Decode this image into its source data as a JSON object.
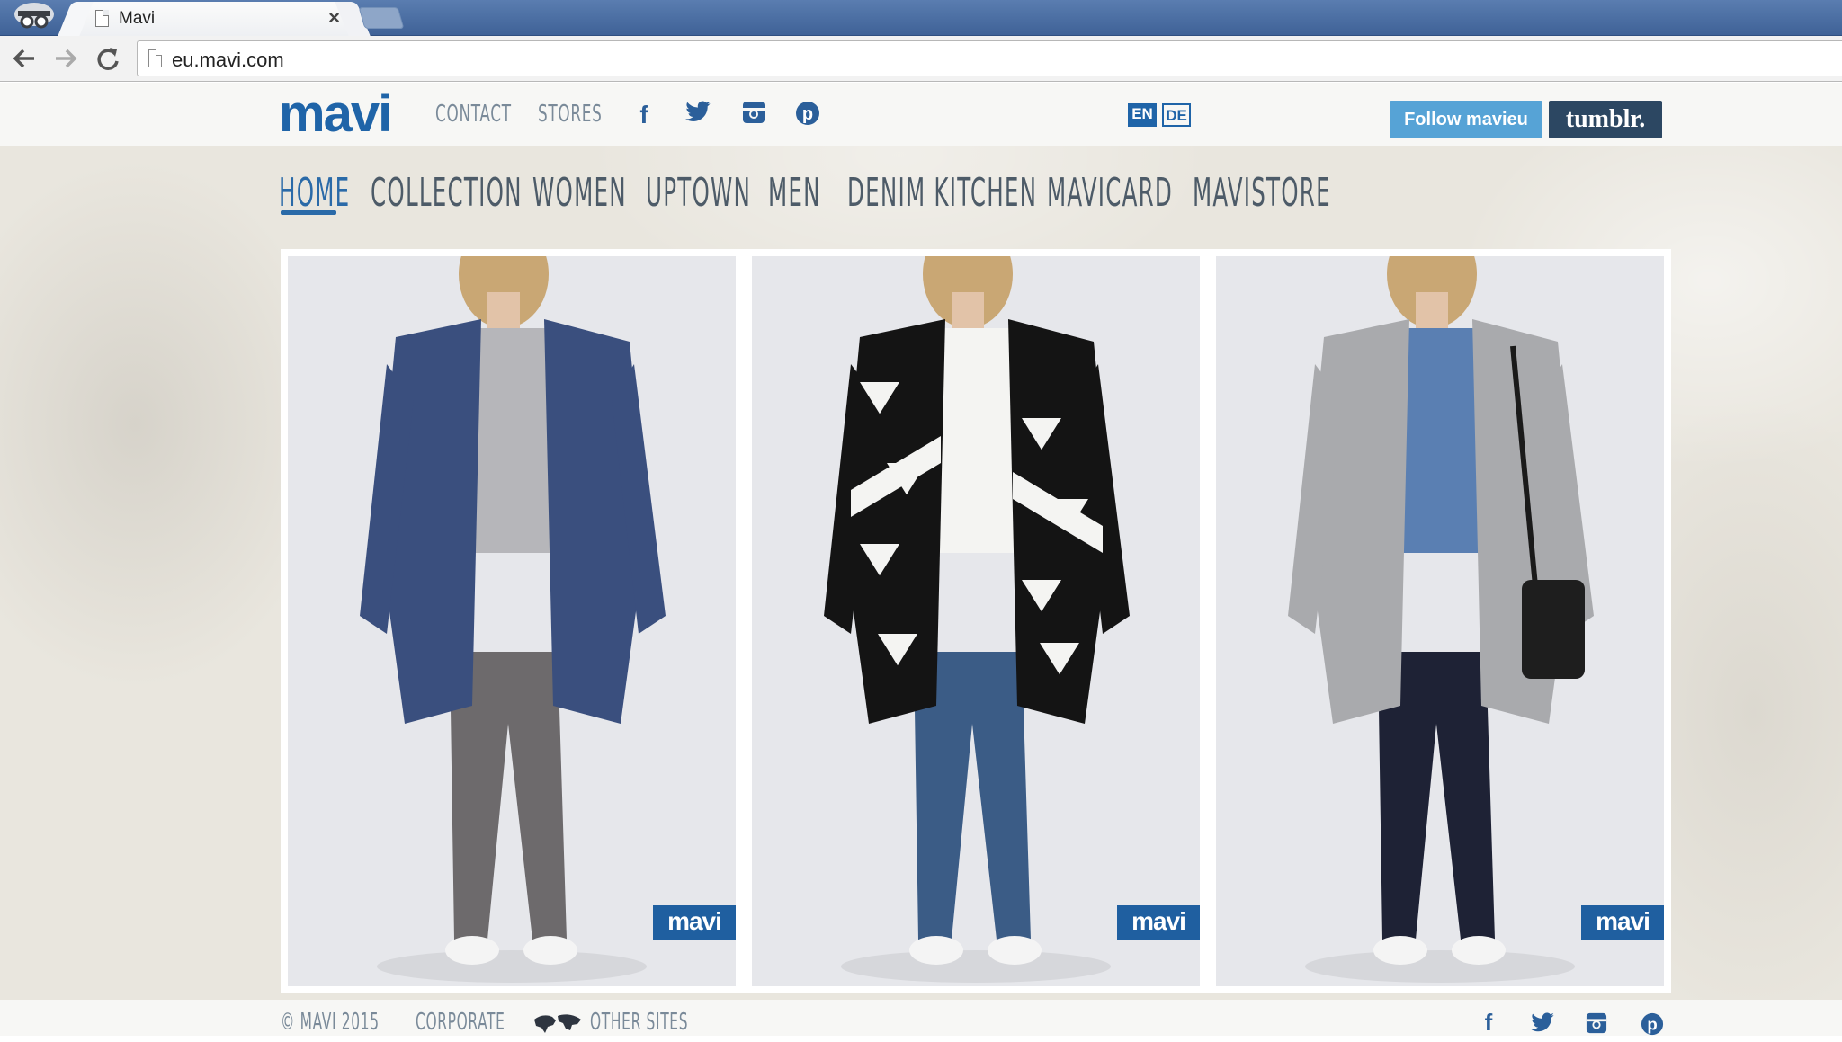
{
  "browser": {
    "tab_title": "Mavi",
    "tab_close": "×",
    "url": "eu.mavi.com"
  },
  "header": {
    "logo": "mavi",
    "links": [
      "CONTACT",
      "STORES"
    ],
    "social_icons": [
      "facebook-icon",
      "twitter-icon",
      "instagram-icon",
      "pinterest-icon"
    ],
    "languages": [
      "EN",
      "DE"
    ],
    "follow_label": "Follow mavieu",
    "tumblr_label": "tumblr."
  },
  "nav": {
    "items": [
      "HOME",
      "COLLECTION",
      "WOMEN",
      "UPTOWN",
      "MEN",
      "DENIM KITCHEN",
      "MAVICARD",
      "MAVISTORE"
    ],
    "active": "HOME"
  },
  "gallery": {
    "badge": "mavi",
    "cards": [
      {
        "coat": "#3a4f7e",
        "coat_inner": "#b6b6ba",
        "pants": "#6d6a6c"
      },
      {
        "coat": "#141414",
        "coat_inner": "#f4f4f2",
        "pants": "#3b5c86"
      },
      {
        "coat": "#a9aaad",
        "coat_inner": "#5a7fb2",
        "pants": "#1e2235"
      }
    ]
  },
  "footer": {
    "copyright": "© MAVI 2015",
    "corporate": "CORPORATE",
    "other_sites": "OTHER SITES"
  },
  "colors": {
    "brand": "#1f64a8",
    "tumblr": "#2c4762",
    "follow": "#56a3d6"
  }
}
